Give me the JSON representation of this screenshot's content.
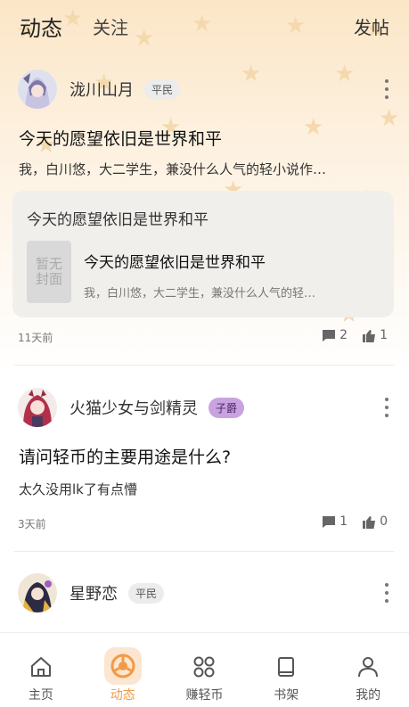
{
  "header": {
    "tabs": [
      {
        "label": "动态",
        "active": true
      },
      {
        "label": "关注",
        "active": false
      }
    ],
    "post_button": "发帖"
  },
  "posts": [
    {
      "user": "泷川山月",
      "badge": "平民",
      "title": "今天的愿望依旧是世界和平",
      "excerpt": "我，白川悠，大二学生，兼没什么人气的轻小说作…",
      "quote": {
        "title": "今天的愿望依旧是世界和平",
        "cover_text": "暂无封面",
        "book_title": "今天的愿望依旧是世界和平",
        "book_desc": "我，白川悠，大二学生，兼没什么人气的轻…"
      },
      "time": "11天前",
      "comments": "2",
      "likes": "1"
    },
    {
      "user": "火猫少女与剑精灵",
      "badge": "子爵",
      "title": "请问轻币的主要用途是什么?",
      "excerpt": "太久没用lk了有点懵",
      "time": "3天前",
      "comments": "1",
      "likes": "0"
    },
    {
      "user": "星野恋",
      "badge": "平民"
    }
  ],
  "nav": [
    {
      "label": "主页",
      "icon": "home-icon",
      "active": false
    },
    {
      "label": "动态",
      "icon": "feed-icon",
      "active": true
    },
    {
      "label": "赚轻币",
      "icon": "grid-icon",
      "active": false
    },
    {
      "label": "书架",
      "icon": "bookshelf-icon",
      "active": false
    },
    {
      "label": "我的",
      "icon": "profile-icon",
      "active": false
    }
  ],
  "colors": {
    "accent": "#f29a45",
    "header_bg": "#fbe6c7",
    "badge_purple": "#c9a3e0",
    "badge_grey": "#ececec"
  }
}
